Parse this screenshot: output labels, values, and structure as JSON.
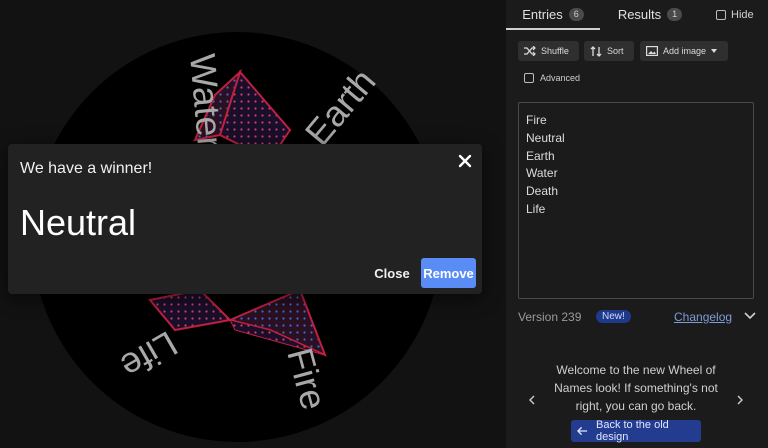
{
  "wheel": {
    "labels": [
      "Water",
      "Earth",
      "Fire",
      "Life"
    ]
  },
  "dialog": {
    "title": "We have a winner!",
    "winner": "Neutral",
    "close_label": "Close",
    "remove_label": "Remove"
  },
  "tabs": {
    "entries_label": "Entries",
    "entries_count": "6",
    "results_label": "Results",
    "results_count": "1",
    "hide_label": "Hide"
  },
  "toolbar": {
    "shuffle_label": "Shuffle",
    "sort_label": "Sort",
    "add_image_label": "Add image",
    "advanced_label": "Advanced"
  },
  "entries": [
    "Fire",
    "Neutral",
    "Earth",
    "Water",
    "Death",
    "Life"
  ],
  "version": {
    "text": "Version 239",
    "new_badge": "New!",
    "changelog_label": "Changelog"
  },
  "welcome": {
    "message": "Welcome to the new Wheel of Names look! If something's not right, you can go back.",
    "back_button_label": "Back to the old design"
  },
  "colors": {
    "accent": "#5a8cf5",
    "badge_blue": "#1f3a8a",
    "back_button": "#243c8f",
    "panel": "#1b1b1b",
    "dialog": "#222222"
  }
}
